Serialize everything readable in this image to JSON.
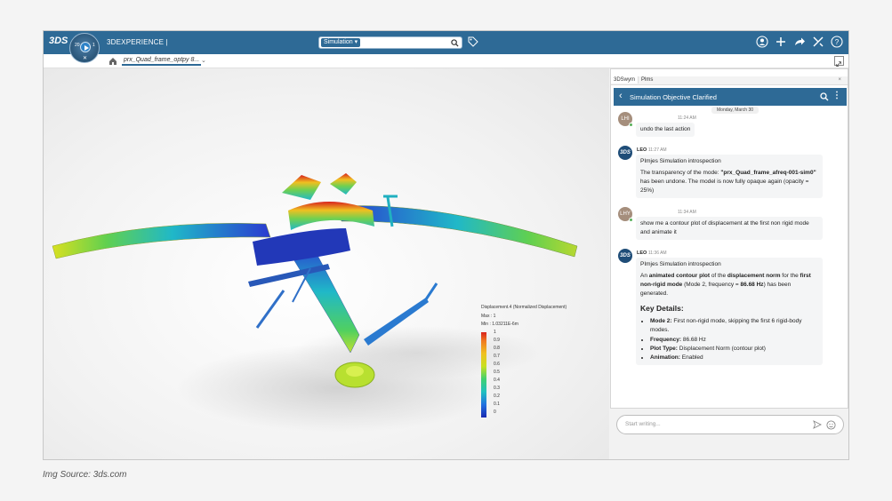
{
  "topbar": {
    "logo": "3DS",
    "compass_labels": [
      "20",
      "1"
    ],
    "brand": "3DEXPERIENCE |",
    "search_scope": "Simulation ▾",
    "search_value": ""
  },
  "subbar": {
    "tab_label": "prx_Quad_frame_optpy 8...",
    "tab_chevron": "⌄"
  },
  "legend": {
    "title": "Displacement.4 (Normalized Displacement)",
    "max": "Max : 1",
    "min": "Min : 1.03211E-6m",
    "ticks": [
      "1",
      "0.9",
      "0.8",
      "0.7",
      "0.6",
      "0.5",
      "0.4",
      "0.3",
      "0.2",
      "0.1",
      "0"
    ],
    "colors": [
      "#d8221d",
      "#f07820",
      "#f0c020",
      "#c8e020",
      "#40d070",
      "#20c0c0",
      "#2070e0",
      "#1a2ab0"
    ]
  },
  "panel": {
    "tabs": [
      "3DSwym",
      "Plms"
    ],
    "close": "×",
    "chat_title": "Simulation Objective Clarified",
    "date": "Monday, March 30",
    "messages": [
      {
        "initials": "LHI",
        "time": "11:24 AM",
        "text": "undo the last action"
      },
      {
        "sender": "LEO",
        "time": "11:27 AM",
        "source": "PImjes Simulation introspection",
        "text_a": "The transparency of the mode: ",
        "text_b": "\"prx_Quad_frame_afreq-001-sim0\"",
        "text_c": " has been undone. The model is now fully opaque again (opacity = 25%)"
      },
      {
        "initials": "LHY",
        "time": "11:34 AM",
        "text": "show me a contour plot of displacement at the first non rigid mode and animate it"
      },
      {
        "sender": "LEO",
        "time": "11:36 AM",
        "source": "PImjes Simulation introspection",
        "p1": "An ",
        "p2": "animated contour plot",
        "p3": " of the ",
        "p4": "displacement norm",
        "p5": " for the ",
        "p6": "first non-rigid mode",
        "p7": " (Mode 2, frequency = ",
        "p8": "86.68 Hz",
        "p9": ") has been generated.",
        "key_details": "Key Details:",
        "bullets": [
          {
            "label": "Mode 2:",
            "value": " First non-rigid mode, skipping the first 6 rigid-body modes."
          },
          {
            "label": "Frequency:",
            "value": " 86.68 Hz"
          },
          {
            "label": "Plot Type:",
            "value": " Displacement Norm (contour plot)"
          },
          {
            "label": "Animation:",
            "value": " Enabled"
          }
        ]
      }
    ],
    "composer_placeholder": "Start writing..."
  },
  "caption": "Img Source: 3ds.com"
}
